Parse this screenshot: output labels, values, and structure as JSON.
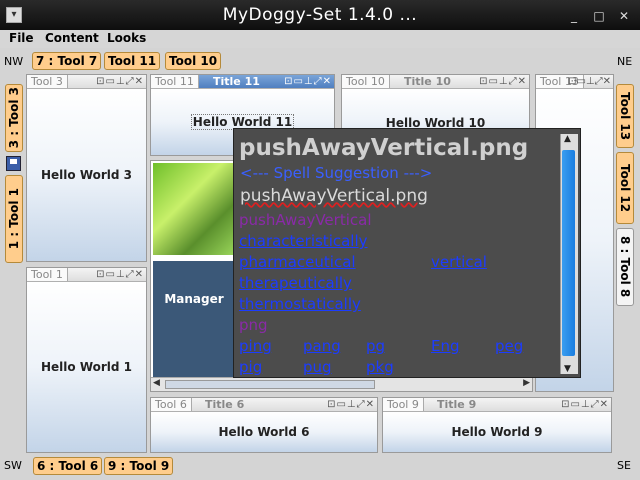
{
  "window": {
    "title": "MyDoggy-Set 1.4.0 ...",
    "btn_min": "_",
    "btn_max": "□",
    "btn_close": "✕"
  },
  "menu": [
    "File",
    "Content",
    "Looks"
  ],
  "corners": {
    "nw": "NW",
    "ne": "NE",
    "sw": "SW",
    "se": "SE"
  },
  "top_bar": [
    "7 : Tool 7",
    "Tool 11",
    "Tool 10"
  ],
  "bottom_bar": [
    "6 : Tool 6",
    "9 : Tool 9"
  ],
  "left_bar": [
    "3 : Tool 3",
    "1 : Tool 1"
  ],
  "right_bar": [
    "Tool 13",
    "Tool 12",
    "8 : Tool 8"
  ],
  "panels": {
    "tool3": {
      "tab": "Tool 3",
      "title": "",
      "content": "Hello World 3"
    },
    "tool1": {
      "tab": "Tool 1",
      "title": "",
      "content": "Hello World 1"
    },
    "tool11": {
      "tab": "Tool 11",
      "title": "Title 11",
      "content": "Hello World 11"
    },
    "tool10": {
      "tab": "Tool 10",
      "title": "Title 10",
      "content": "Hello World 10"
    },
    "tool13": {
      "tab": "Tool 13",
      "title": "",
      "content": ""
    },
    "tool6": {
      "tab": "Tool 6",
      "title": "Title 6",
      "content": "Hello World 6"
    },
    "tool9": {
      "tab": "Tool 9",
      "title": "Title 9",
      "content": "Hello World 9"
    }
  },
  "center": {
    "manager_label": "Manager"
  },
  "panel_icons": "⊡▭⊥⤢✕",
  "popup": {
    "title": "pushAwayVertical.png",
    "suggestion_header": "<--- Spell Suggestion --->",
    "misspelled": "pushAwayVertical.png",
    "words": {
      "w1": "pushAwayVertical",
      "w2": "characteristically",
      "w3": "pharmaceutical",
      "w4": "vertical",
      "w5": "therapeutically",
      "w6": "thermostatically",
      "w7": "png",
      "w8": "ping",
      "w9": "pang",
      "w10": "pg",
      "w11": "Eng",
      "w12": "peg",
      "w13": "pig",
      "w14": "pug",
      "w15": "pkg"
    }
  },
  "colors": {
    "tool_button": "#ffcd8c",
    "active_header": "#4f7fc0",
    "popup_bg": "#4c4c4c",
    "link": "#1c3cff",
    "scroll_thumb": "#1a7de0"
  }
}
